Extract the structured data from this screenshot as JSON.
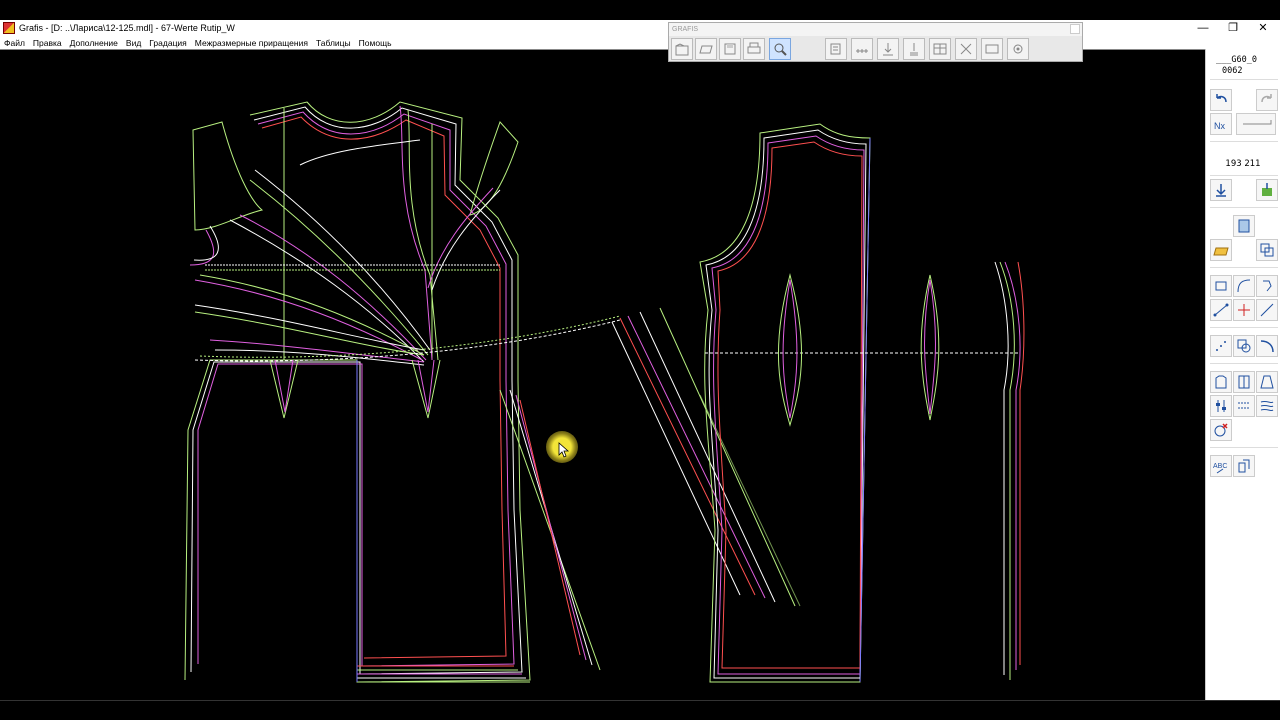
{
  "window": {
    "title": "Grafis - [D: ..\\Лариса\\12-125.mdl] - 67-Werte Rutip_W",
    "minimize_glyph": "—",
    "maximize_glyph": "❐",
    "close_glyph": "✕"
  },
  "menu": {
    "items": [
      "Файл",
      "Правка",
      "Дополнение",
      "Вид",
      "Градация",
      "Межразмерные приращения",
      "Таблицы",
      "Помощь"
    ]
  },
  "grafis_toolbar": {
    "title": "GRAFIS",
    "buttons": [
      "open-icon",
      "folder-open-icon",
      "save-icon",
      "print-icon",
      "zoom-icon",
      "layer-icon",
      "measure-icon",
      "download-icon",
      "insert-icon",
      "table-icon",
      "grid-icon",
      "size-icon",
      "settings-icon"
    ]
  },
  "right_panel": {
    "size_line1": "___G60_0",
    "size_line2": "0062",
    "coordinates": "193 211",
    "buttons": [
      "undo-icon",
      "redo-icon",
      "nx-icon",
      "line-icon",
      "arrow-down-icon",
      "piece-icon",
      "book-icon",
      "folder-icon",
      "copy-icon",
      "rect-icon",
      "curve-icon",
      "rotate-icon",
      "point-line-icon",
      "cross-icon",
      "diagonal-icon",
      "dots-icon",
      "shape-icon",
      "arc-icon",
      "shirt-icon",
      "pattern-icon",
      "dress-icon",
      "slider-icon",
      "dotted-icon",
      "sweep-icon",
      "delete-icon",
      "abc-icon",
      "clone-icon"
    ]
  },
  "colors": {
    "line_green": "#b8f080",
    "line_magenta": "#e060e0",
    "line_white": "#ffffff",
    "line_blue": "#7a7aff",
    "line_red": "#ff5050",
    "cursor_yellow": "#f0e040"
  }
}
